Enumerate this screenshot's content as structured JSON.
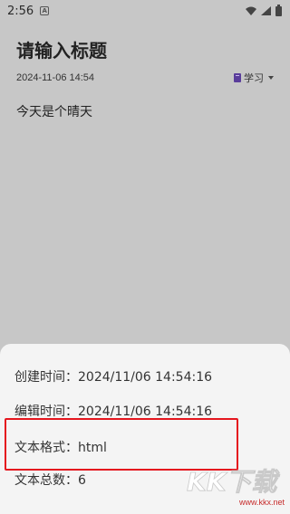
{
  "status_bar": {
    "time": "2:56",
    "notification_glyph": "A",
    "icons": [
      "wifi-icon",
      "signal-icon",
      "battery-icon"
    ]
  },
  "note": {
    "title": "请输入标题",
    "date": "2024-11-06 14:54",
    "category": "学习",
    "category_icon": "book-icon",
    "body": "今天是个晴天"
  },
  "sheet": {
    "created": "创建时间：2024/11/06 14:54:16",
    "edited": "编辑时间：2024/11/06 14:54:16",
    "format": "文本格式：html",
    "total": "文本总数：6"
  },
  "watermark": {
    "logo_text": "KK下载",
    "url": "www.kkx.net"
  },
  "colors": {
    "overlay_bg": "#c7c7c7",
    "sheet_bg": "#f4f4f4",
    "highlight": "#e5161e",
    "category_icon": "#5a3d9b"
  }
}
